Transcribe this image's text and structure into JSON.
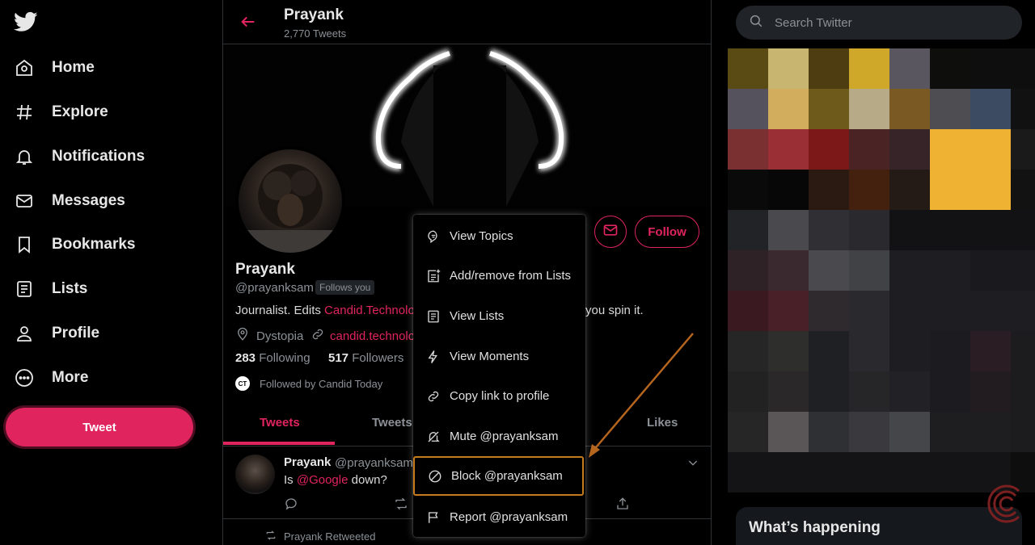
{
  "nav": {
    "items": [
      {
        "label": "Home",
        "icon": "home-icon"
      },
      {
        "label": "Explore",
        "icon": "hashtag-icon"
      },
      {
        "label": "Notifications",
        "icon": "bell-icon"
      },
      {
        "label": "Messages",
        "icon": "mail-icon"
      },
      {
        "label": "Bookmarks",
        "icon": "bookmark-icon"
      },
      {
        "label": "Lists",
        "icon": "list-icon"
      },
      {
        "label": "Profile",
        "icon": "person-icon"
      },
      {
        "label": "More",
        "icon": "more-icon"
      }
    ],
    "tweet_button": "Tweet"
  },
  "header": {
    "name": "Prayank",
    "tweet_count": "2,770 Tweets"
  },
  "profile": {
    "name": "Prayank",
    "handle": "@prayanksam",
    "follows_you": "Follows you",
    "bio_start": "Journalist. Edits ",
    "bio_link": "Candid.Technolo",
    "bio_end": "you spin it.",
    "location": "Dystopia",
    "website": "candid.technolo",
    "following_count": "283",
    "following_label": "Following",
    "followers_count": "517",
    "followers_label": "Followers",
    "followed_by": "Followed by Candid Today",
    "followed_by_badge": "CT",
    "follow_button": "Follow"
  },
  "tabs": [
    "Tweets",
    "Tweets",
    "Likes"
  ],
  "tweet": {
    "name": "Prayank",
    "handle": "@prayanksam",
    "text_start": "Is ",
    "mention": "@Google",
    "text_end": " down?"
  },
  "retweeted_label": "Prayank Retweeted",
  "menu": {
    "items": [
      {
        "label": "View Topics",
        "icon": "topics-icon"
      },
      {
        "label": "Add/remove from Lists",
        "icon": "list-add-icon"
      },
      {
        "label": "View Lists",
        "icon": "list-icon"
      },
      {
        "label": "View Moments",
        "icon": "lightning-icon"
      },
      {
        "label": "Copy link to profile",
        "icon": "link-icon"
      },
      {
        "label": "Mute @prayanksam",
        "icon": "mute-icon"
      },
      {
        "label": "Block @prayanksam",
        "icon": "block-icon"
      },
      {
        "label": "Report @prayanksam",
        "icon": "flag-icon"
      }
    ]
  },
  "search": {
    "placeholder": "Search Twitter"
  },
  "whats_happening": "What’s happening",
  "colors": {
    "accent": "#e0245e",
    "highlight_border": "#c67a1e",
    "annotation_arrow": "#b5651d",
    "background": "#000000",
    "text_secondary": "#8b9196"
  },
  "pixelated_panel": [
    "#5a4a14",
    "#c7b570",
    "#4e3d10",
    "#cfa82a",
    "#5a5660",
    "#0e0e0c",
    "#0e0e0e",
    "#0e0e0e",
    "#55525e",
    "#d2ad5e",
    "#6e5a1a",
    "#b7aa86",
    "#7a5a22",
    "#4e4e52",
    "#3c4a62",
    "#111111",
    "#7a3030",
    "#9a3036",
    "#7c1818",
    "#4a2424",
    "#362428",
    "#f0b232",
    "#f0b232",
    "#1a1a1a",
    "#0a0a0a",
    "#070707",
    "#2a1a12",
    "#44200f",
    "#241a16",
    "#f0b232",
    "#f0b232",
    "#121212",
    "#222326",
    "#4a4a4e",
    "#303034",
    "#2a2a2e",
    "#121214",
    "#121214",
    "#121214",
    "#121214",
    "#2e2226",
    "#3a2a30",
    "#4a4a4e",
    "#404246",
    "#1e1e22",
    "#1e1e22",
    "#1a1a1e",
    "#1a1a1e",
    "#3a1a20",
    "#4a2028",
    "#2e2a2e",
    "#2a2a2e",
    "#1e1e22",
    "#1e1e22",
    "#1e1e22",
    "#1e1e22",
    "#262626",
    "#2e2e2c",
    "#1e2024",
    "#2a2a2e",
    "#1e1e22",
    "#1c1c20",
    "#2a1e24",
    "#1c1c1e",
    "#222222",
    "#2a2828",
    "#1e2024",
    "#262628",
    "#222226",
    "#1c1c20",
    "#221c20",
    "#1c1c1e",
    "#262626",
    "#5a5658",
    "#2e3034",
    "#3a3a3e",
    "#44464a",
    "#1e1e20",
    "#1e1e20",
    "#1c1c1e",
    "#141416",
    "#141416",
    "#141416",
    "#141416",
    "#141416",
    "#141416",
    "#141416",
    "#0e0e0e"
  ]
}
